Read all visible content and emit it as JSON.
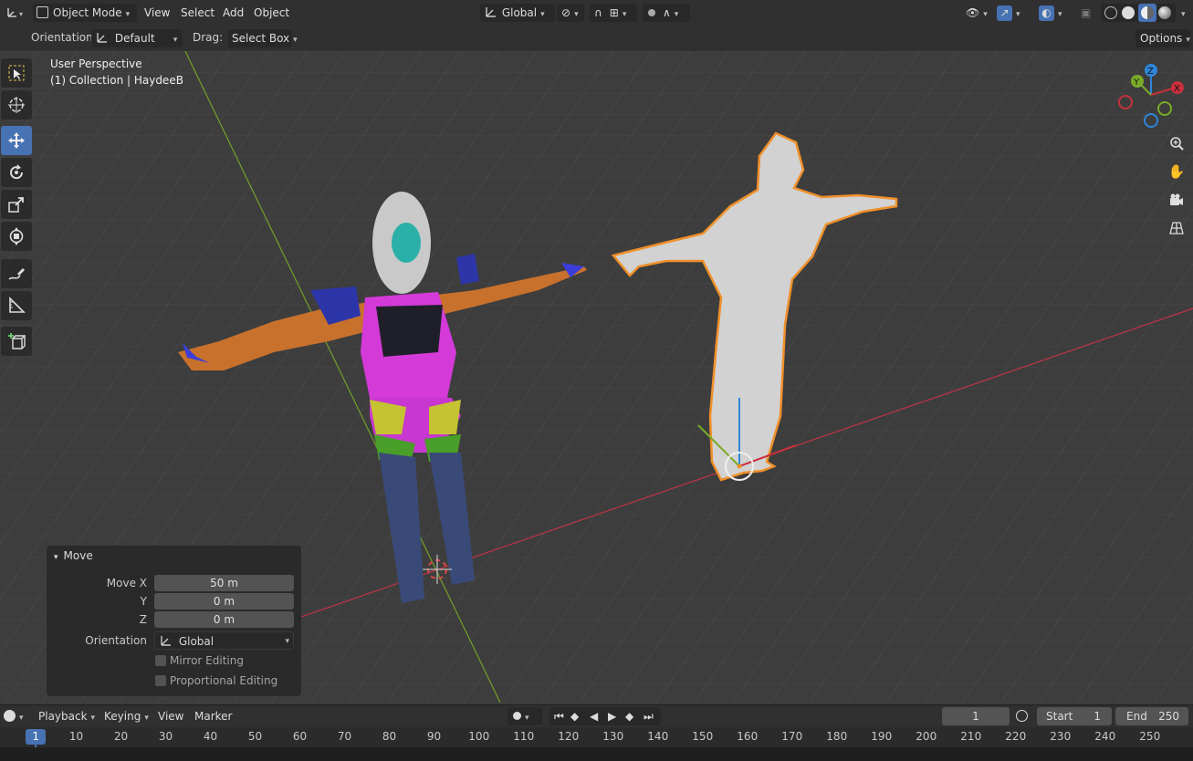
{
  "header": {
    "mode": "Object Mode",
    "menus": [
      "View",
      "Select",
      "Add",
      "Object"
    ],
    "transform_orientation": "Global"
  },
  "tool_header": {
    "orientation_label": "Orientation:",
    "orientation_value": "Default",
    "drag_label": "Drag:",
    "drag_value": "Select Box",
    "options": "Options"
  },
  "viewport": {
    "view_name": "User Perspective",
    "collection_info": "(1) Collection | HaydeeB",
    "gizmo": {
      "z": "Z",
      "y": "Y",
      "x": "X"
    }
  },
  "tools": [
    "select-box-tool",
    "cursor-tool",
    "move-tool",
    "rotate-tool",
    "scale-tool",
    "transform-tool",
    "annotate-tool",
    "measure-tool",
    "add-cube-tool"
  ],
  "operator_panel": {
    "title": "Move",
    "move_x_label": "Move X",
    "move_x": "50 m",
    "y_label": "Y",
    "y": "0 m",
    "z_label": "Z",
    "z": "0 m",
    "orientation_label": "Orientation",
    "orientation_value": "Global",
    "mirror_editing": "Mirror Editing",
    "proportional_editing": "Proportional Editing"
  },
  "timeline": {
    "playback": "Playback",
    "keying": "Keying",
    "view": "View",
    "marker": "Marker",
    "current_frame": "1",
    "start_label": "Start",
    "start": "1",
    "end_label": "End",
    "end": "250",
    "ruler": [
      "1",
      "10",
      "20",
      "30",
      "40",
      "50",
      "60",
      "70",
      "80",
      "90",
      "100",
      "110",
      "120",
      "130",
      "140",
      "150",
      "160",
      "170",
      "180",
      "190",
      "200",
      "210",
      "220",
      "230",
      "240",
      "250"
    ]
  },
  "colors": {
    "accent": "#4772b3",
    "x_axis": "#c8303d",
    "y_axis": "#7aab28",
    "z_axis": "#2f86d9",
    "selection": "#f0902a"
  }
}
